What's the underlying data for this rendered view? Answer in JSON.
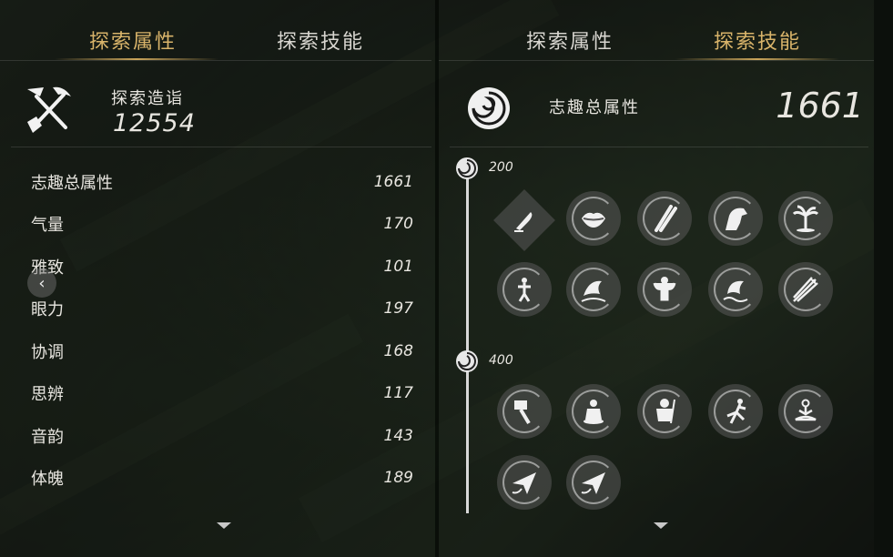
{
  "left_panel": {
    "tabs": [
      {
        "label": "探索属性",
        "active": true
      },
      {
        "label": "探索技能",
        "active": false
      }
    ],
    "proficiency": {
      "label": "探索造诣",
      "value": "12554",
      "icon": "pickaxe-shovel-icon"
    },
    "attributes": [
      {
        "name": "志趣总属性",
        "value": "1661"
      },
      {
        "name": "气量",
        "value": "170"
      },
      {
        "name": "雅致",
        "value": "101"
      },
      {
        "name": "眼力",
        "value": "197"
      },
      {
        "name": "协调",
        "value": "168"
      },
      {
        "name": "思辨",
        "value": "117"
      },
      {
        "name": "音韵",
        "value": "143"
      },
      {
        "name": "体魄",
        "value": "189"
      }
    ],
    "back_icon": "‹"
  },
  "right_panel": {
    "tabs": [
      {
        "label": "探索属性",
        "active": false
      },
      {
        "label": "探索技能",
        "active": true
      }
    ],
    "total": {
      "label": "志趣总属性",
      "value": "1661",
      "icon": "swirl-icon"
    },
    "tiers": [
      {
        "threshold": "200",
        "skills": [
          "quill-icon",
          "lips-icon",
          "bamboo-icon",
          "horse-icon",
          "palm-tree-icon",
          "figure-icon",
          "fish-icon",
          "strongman-icon",
          "fish-jump-icon",
          "arrows-icon"
        ]
      },
      {
        "threshold": "400",
        "skills": [
          "hammer-icon",
          "meditating-monk-icon",
          "warrior-icon",
          "martial-arts-icon",
          "lotus-sitting-icon",
          "paper-plane-icon",
          "paper-plane-icon"
        ]
      }
    ]
  },
  "colors": {
    "accent": "#d9b46a",
    "text": "#e8e6e0"
  }
}
